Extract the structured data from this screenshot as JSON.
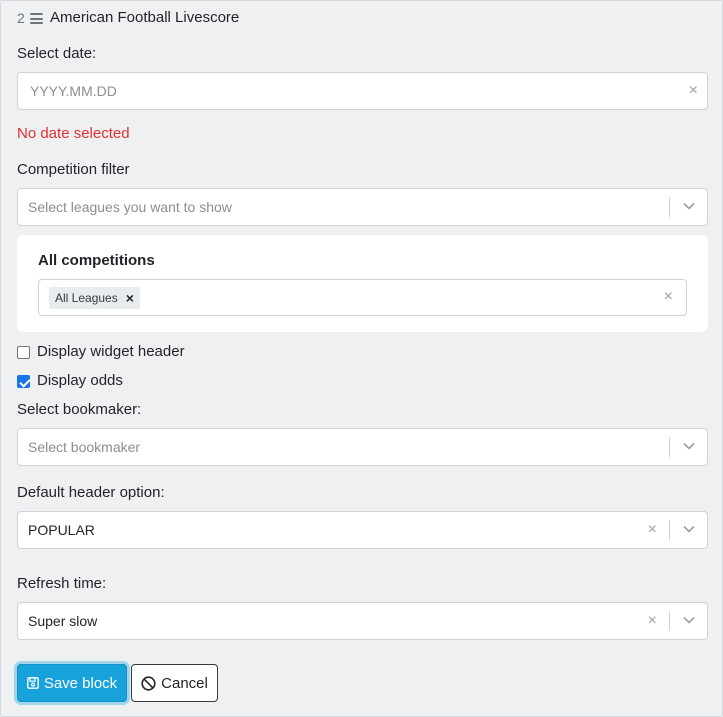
{
  "header": {
    "number": "2",
    "title": "American Football Livescore"
  },
  "date": {
    "label": "Select date:",
    "placeholder": "YYYY.MM.DD",
    "clear": "×",
    "error": "No date selected"
  },
  "competition": {
    "label": "Competition filter",
    "placeholder": "Select leagues you want to show",
    "card_title": "All competitions",
    "tags": [
      "All Leagues"
    ],
    "tag_remove": "×",
    "clear": "×"
  },
  "options": {
    "display_header": {
      "label": "Display widget header",
      "checked": false
    },
    "display_odds": {
      "label": "Display odds",
      "checked": true
    }
  },
  "bookmaker": {
    "label": "Select bookmaker:",
    "placeholder": "Select bookmaker"
  },
  "default_header": {
    "label": "Default header option:",
    "value": "POPULAR",
    "clear": "×"
  },
  "refresh": {
    "label": "Refresh time:",
    "value": "Super slow",
    "clear": "×"
  },
  "actions": {
    "save": "Save block",
    "cancel": "Cancel"
  },
  "colors": {
    "primary": "#17a2dc",
    "error": "#e03131",
    "checkbox": "#1a73e8"
  }
}
